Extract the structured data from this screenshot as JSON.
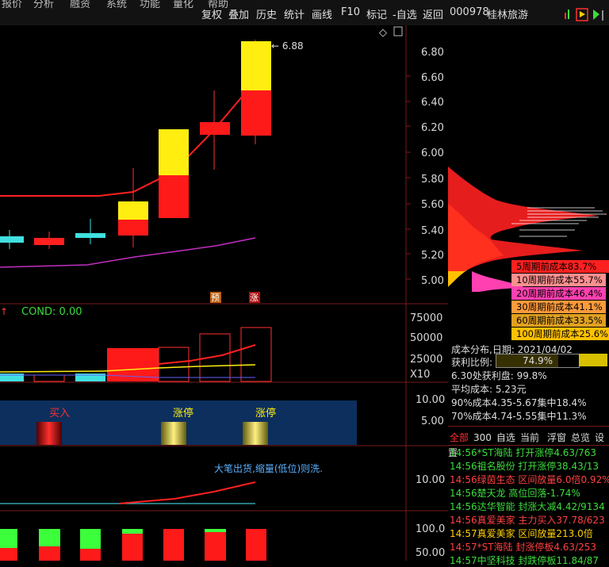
{
  "toolbar": {
    "left_items": [
      "报价",
      "分析",
      "融资",
      "系统",
      "功能",
      "量化",
      "帮助"
    ],
    "items": [
      "复权",
      "叠加",
      "历史",
      "统计",
      "画线",
      "F10",
      "标记",
      "-自选",
      "返回"
    ]
  },
  "stock": {
    "code": "000978",
    "name": "桂林旅游"
  },
  "main_chart": {
    "high_label": "6.88",
    "right_axis": [
      "6.80",
      "6.60",
      "6.40",
      "6.20",
      "6.00",
      "5.80",
      "5.60",
      "5.40",
      "5.20",
      "5.00"
    ],
    "markers": [
      "预",
      "涨"
    ]
  },
  "volume_panel": {
    "cond_label": "COND: 0.00",
    "axis": [
      "75000",
      "50000",
      "25000"
    ],
    "unit": "X10"
  },
  "signal_panel": {
    "labels": [
      "买入",
      "涨停",
      "涨停"
    ],
    "axis": [
      "10.00",
      "5.00"
    ]
  },
  "ma_panel": {
    "text": "大笔出货,缩量(低位)则洗.",
    "axis": [
      "10.00"
    ]
  },
  "bottom_panel": {
    "axis": [
      "100.0",
      "50.00"
    ]
  },
  "chip": {
    "cost_rows": [
      {
        "label": "5周期前成本83.7%",
        "color": "#ff2020"
      },
      {
        "label": "10周期前成本55.7%",
        "color": "#ff9090"
      },
      {
        "label": "20周期前成本46.4%",
        "color": "#ff40b0"
      },
      {
        "label": "30周期前成本41.1%",
        "color": "#ff9a3a"
      },
      {
        "label": "60周期前成本33.5%",
        "color": "#e0a020"
      },
      {
        "label": "100周期前成本25.6%",
        "color": "#ffc000"
      }
    ],
    "dist_date": "成本分布,日期: 2021/04/02",
    "profit_label": "获利比例:",
    "profit_value": "74.9%",
    "profit_line": "6.30处获利盘: 99.8%",
    "avg_cost": "平均成本: 5.23元",
    "c90": "90%成本4.35-5.67集中18.4%",
    "c70": "70%成本4.74-5.55集中11.3%"
  },
  "tabs": [
    "全部",
    "300",
    "自选",
    "当前",
    "浮窗",
    "总览",
    "设置"
  ],
  "news": [
    {
      "text": "14:56*ST海陆 打开涨停4.63/763",
      "color": "#3cdc3c"
    },
    {
      "text": "14:56祖名股份 打开涨停38.43/13",
      "color": "#3cdc3c"
    },
    {
      "text": "14:56绿茵生态 区间放量6.0倍0.92%",
      "color": "#ff4040"
    },
    {
      "text": "14:56楚天龙   高位回落-1.74%",
      "color": "#3cdc3c"
    },
    {
      "text": "14:56达华智能 封涨大减4.42/9134",
      "color": "#3cdc3c"
    },
    {
      "text": "14:56真爱美家 主力买入37.78/623",
      "color": "#ff4040"
    },
    {
      "text": "14:57真爱美家 区间放量213.0倍",
      "color": "#ffd000"
    },
    {
      "text": "14:57*ST海陆  封涨停板4.63/253",
      "color": "#ff4040"
    },
    {
      "text": "14:57中坚科技 封跌停板11.84/87",
      "color": "#3cdc3c"
    }
  ]
}
